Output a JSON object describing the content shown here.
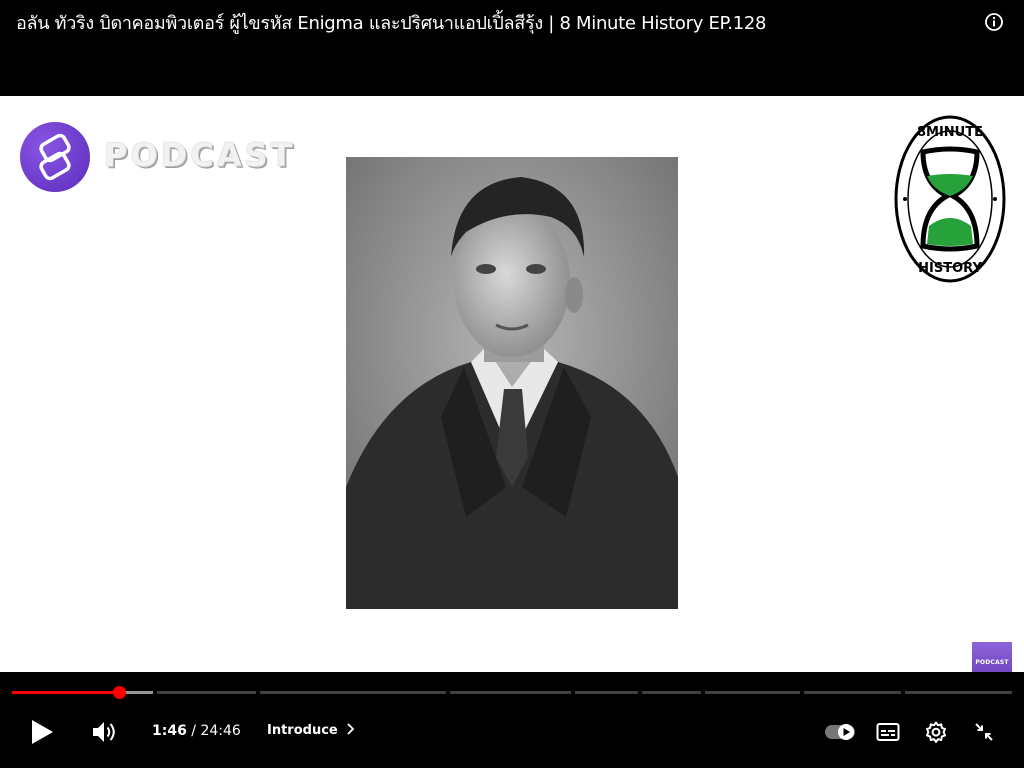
{
  "video": {
    "title": "อลัน ทัวริง บิดาคอมพิวเตอร์ ผู้ไขรหัส Enigma และปริศนาแอปเปิ้ลสีรุ้ง | 8 Minute History EP.128"
  },
  "overlay": {
    "podcast_label": "PODCAST",
    "badge_label": "PODCAST"
  },
  "history_logo": {
    "top_text": "8MINUTE",
    "bottom_text": "HISTORY",
    "sand_color": "#27a13a"
  },
  "player": {
    "current_time": "1:46",
    "separator": " / ",
    "duration": "24:46",
    "chapter_label": "Introduce",
    "progress_fraction": 0.107,
    "accent_color": "#ff0000"
  },
  "icons": [
    "info-icon",
    "play-icon",
    "volume-icon",
    "chevron-right-icon",
    "autoplay-toggle-icon",
    "subtitles-icon",
    "settings-icon",
    "exit-fullscreen-icon"
  ]
}
